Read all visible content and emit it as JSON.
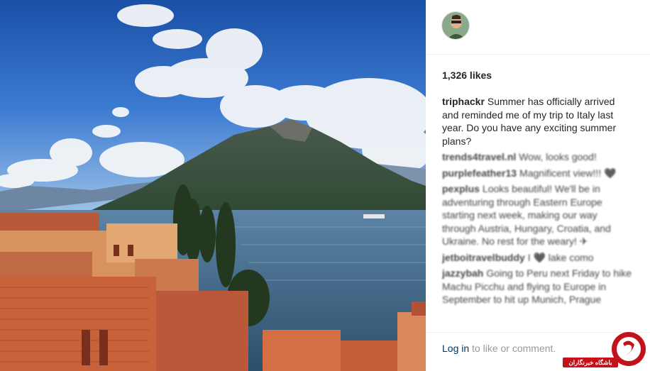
{
  "post": {
    "likes": "1,326 likes"
  },
  "caption": {
    "user": "triphackr",
    "text": "Summer has officially arrived and reminded me of my trip to Italy last year. Do you have any exciting summer plans?"
  },
  "comments": [
    {
      "user": "trends4travel.nl",
      "text": "Wow, looks good!"
    },
    {
      "user": "purplefeather13",
      "text": "Magnificent view!!! 🖤"
    },
    {
      "user": "pexplus",
      "text": "Looks beautiful! We'll be in adventuring through Eastern Europe starting next week, making our way through Austria, Hungary, Croatia, and Ukraine. No rest for the weary! ✈"
    },
    {
      "user": "jetboitravelbuddy",
      "text": "I 🖤 lake como"
    },
    {
      "user": "jazzybah",
      "text": "Going to Peru next Friday to hike Machu Picchu and flying to Europe in September to hit up Munich, Prague"
    }
  ],
  "footer": {
    "login_link": "Log in",
    "login_rest": "to like or comment."
  },
  "watermark": {
    "label": "باشگاه خبرنگاران"
  },
  "colors": {
    "sky": "#1f5fb8",
    "lake": "#3d6b8e",
    "roof": "#c8623a",
    "link": "#003569",
    "watermark_red": "#c4121a"
  },
  "icons": {
    "avatar": "user-avatar",
    "watermark": "yjc-logo-icon"
  }
}
